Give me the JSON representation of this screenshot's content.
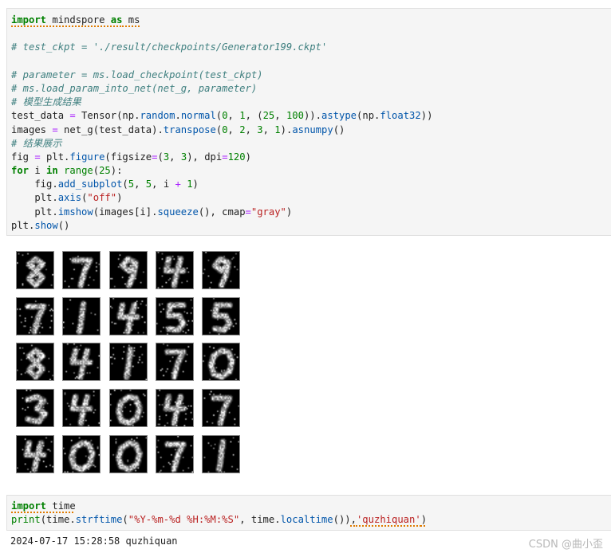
{
  "cell1": {
    "lines": [
      {
        "segments": [
          {
            "t": "import",
            "c": "kw squig"
          },
          {
            "t": " mindspore ",
            "c": "squig"
          },
          {
            "t": "as",
            "c": "kw squig"
          },
          {
            "t": " ms",
            "c": "squig"
          }
        ]
      },
      {
        "segments": []
      },
      {
        "segments": [
          {
            "t": "# test_ckpt = './result/checkpoints/Generator199.ckpt'",
            "c": "cm"
          }
        ]
      },
      {
        "segments": []
      },
      {
        "segments": [
          {
            "t": "# parameter = ms.load_checkpoint(test_ckpt)",
            "c": "cm"
          }
        ]
      },
      {
        "segments": [
          {
            "t": "# ms.load_param_into_net(net_g, parameter)",
            "c": "cm"
          }
        ]
      },
      {
        "segments": [
          {
            "t": "# 模型生成结果",
            "c": "cm"
          }
        ]
      },
      {
        "segments": [
          {
            "t": "test_data "
          },
          {
            "t": "=",
            "c": "op"
          },
          {
            "t": " Tensor(np."
          },
          {
            "t": "random",
            "c": "fn"
          },
          {
            "t": "."
          },
          {
            "t": "normal",
            "c": "fn"
          },
          {
            "t": "("
          },
          {
            "t": "0",
            "c": "num"
          },
          {
            "t": ", "
          },
          {
            "t": "1",
            "c": "num"
          },
          {
            "t": ", ("
          },
          {
            "t": "25",
            "c": "num"
          },
          {
            "t": ", "
          },
          {
            "t": "100",
            "c": "num"
          },
          {
            "t": "))."
          },
          {
            "t": "astype",
            "c": "fn"
          },
          {
            "t": "(np."
          },
          {
            "t": "float32",
            "c": "fn"
          },
          {
            "t": "))"
          }
        ]
      },
      {
        "segments": [
          {
            "t": "images "
          },
          {
            "t": "=",
            "c": "op"
          },
          {
            "t": " net_g(test_data)."
          },
          {
            "t": "transpose",
            "c": "fn"
          },
          {
            "t": "("
          },
          {
            "t": "0",
            "c": "num"
          },
          {
            "t": ", "
          },
          {
            "t": "2",
            "c": "num"
          },
          {
            "t": ", "
          },
          {
            "t": "3",
            "c": "num"
          },
          {
            "t": ", "
          },
          {
            "t": "1",
            "c": "num"
          },
          {
            "t": ")."
          },
          {
            "t": "asnumpy",
            "c": "fn"
          },
          {
            "t": "()"
          }
        ]
      },
      {
        "segments": [
          {
            "t": "# 结果展示",
            "c": "cm"
          }
        ]
      },
      {
        "segments": [
          {
            "t": "fig "
          },
          {
            "t": "=",
            "c": "op"
          },
          {
            "t": " plt."
          },
          {
            "t": "figure",
            "c": "fn"
          },
          {
            "t": "(figsize"
          },
          {
            "t": "=",
            "c": "op"
          },
          {
            "t": "("
          },
          {
            "t": "3",
            "c": "num"
          },
          {
            "t": ", "
          },
          {
            "t": "3",
            "c": "num"
          },
          {
            "t": "), dpi"
          },
          {
            "t": "=",
            "c": "op"
          },
          {
            "t": "120",
            "c": "num"
          },
          {
            "t": ")"
          }
        ]
      },
      {
        "segments": [
          {
            "t": "for",
            "c": "kw"
          },
          {
            "t": " i "
          },
          {
            "t": "in",
            "c": "kw"
          },
          {
            "t": " "
          },
          {
            "t": "range",
            "c": "num"
          },
          {
            "t": "("
          },
          {
            "t": "25",
            "c": "num"
          },
          {
            "t": "):"
          }
        ]
      },
      {
        "segments": [
          {
            "t": "    fig."
          },
          {
            "t": "add_subplot",
            "c": "fn"
          },
          {
            "t": "("
          },
          {
            "t": "5",
            "c": "num"
          },
          {
            "t": ", "
          },
          {
            "t": "5",
            "c": "num"
          },
          {
            "t": ", i "
          },
          {
            "t": "+",
            "c": "op"
          },
          {
            "t": " "
          },
          {
            "t": "1",
            "c": "num"
          },
          {
            "t": ")"
          }
        ]
      },
      {
        "segments": [
          {
            "t": "    plt."
          },
          {
            "t": "axis",
            "c": "fn"
          },
          {
            "t": "("
          },
          {
            "t": "\"off\"",
            "c": "str"
          },
          {
            "t": ")"
          }
        ]
      },
      {
        "segments": [
          {
            "t": "    plt."
          },
          {
            "t": "imshow",
            "c": "fn"
          },
          {
            "t": "(images[i]."
          },
          {
            "t": "squeeze",
            "c": "fn"
          },
          {
            "t": "(), cmap"
          },
          {
            "t": "=",
            "c": "op"
          },
          {
            "t": "\"gray\"",
            "c": "str"
          },
          {
            "t": ")"
          }
        ]
      },
      {
        "segments": [
          {
            "t": "plt."
          },
          {
            "t": "show",
            "c": "fn"
          },
          {
            "t": "()"
          }
        ]
      }
    ]
  },
  "figure": {
    "rows": 5,
    "cols": 5,
    "cmap": "gray",
    "digits": [
      8,
      7,
      9,
      4,
      9,
      7,
      1,
      4,
      5,
      5,
      8,
      4,
      1,
      7,
      0,
      3,
      4,
      0,
      4,
      7,
      4,
      0,
      0,
      7,
      1
    ]
  },
  "cell2": {
    "lines": [
      {
        "segments": [
          {
            "t": "import",
            "c": "kw squig"
          },
          {
            "t": " time",
            "c": "squig"
          }
        ]
      },
      {
        "segments": [
          {
            "t": "print",
            "c": "num"
          },
          {
            "t": "(time."
          },
          {
            "t": "strftime",
            "c": "fn"
          },
          {
            "t": "("
          },
          {
            "t": "\"%Y-%m-%d %H:%M:%S\"",
            "c": "str"
          },
          {
            "t": ", time."
          },
          {
            "t": "localtime",
            "c": "fn"
          },
          {
            "t": "())"
          },
          {
            "t": ",",
            "c": "squig"
          },
          {
            "t": "'quzhiquan'",
            "c": "str squig"
          },
          {
            "t": ")",
            "c": "squig"
          }
        ]
      }
    ]
  },
  "output": {
    "text": "2024-07-17 15:28:58 quzhiquan"
  },
  "watermark": {
    "text": "CSDN @曲小歪"
  }
}
